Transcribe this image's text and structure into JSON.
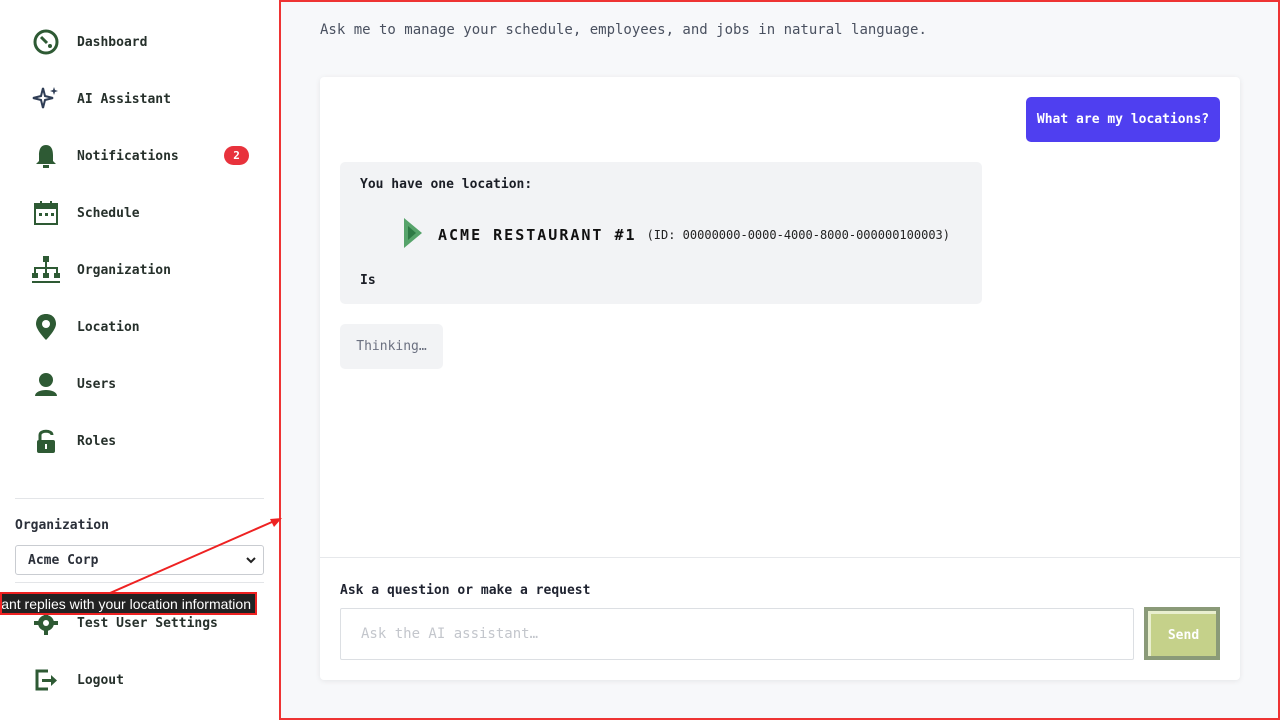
{
  "header": {
    "subtitle": "Ask me to manage your schedule, employees, and jobs in natural language."
  },
  "sidebar": {
    "items": [
      {
        "label": "Dashboard",
        "icon": "dashboard-icon"
      },
      {
        "label": "AI Assistant",
        "icon": "sparkle-icon"
      },
      {
        "label": "Notifications",
        "icon": "bell-icon",
        "badge": "2"
      },
      {
        "label": "Schedule",
        "icon": "calendar-icon"
      },
      {
        "label": "Organization",
        "icon": "org-chart-icon"
      },
      {
        "label": "Location",
        "icon": "map-pin-icon"
      },
      {
        "label": "Users",
        "icon": "user-icon"
      },
      {
        "label": "Roles",
        "icon": "lock-icon"
      }
    ],
    "organization_label": "Organization",
    "organization_value": "Acme Corp",
    "bottom_items": [
      {
        "label": "Test User Settings",
        "icon": "gear-icon"
      },
      {
        "label": "Logout",
        "icon": "logout-icon"
      }
    ]
  },
  "chat": {
    "user_message": "What are my locations?",
    "assistant": {
      "intro": "You have one location:",
      "location_name": "ACME RESTAURANT #1",
      "location_id": "(ID: 00000000-0000-4000-8000-000000100003)",
      "trailing": "Is"
    },
    "thinking": "Thinking…",
    "input_label": "Ask a question or make a request",
    "input_placeholder": "Ask the AI assistant…",
    "input_value": "",
    "send_label": "Send"
  },
  "annotation": {
    "text": "AI assistant replies with your location information"
  },
  "colors": {
    "accent": "#4f3ff0",
    "icon_green": "#2e5a34",
    "badge_red": "#e8323c",
    "send_button": "#c5d18a"
  }
}
